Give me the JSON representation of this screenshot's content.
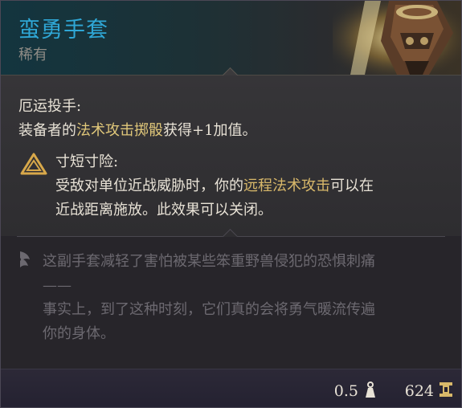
{
  "item": {
    "name": "蛮勇手套",
    "rarity": "稀有"
  },
  "passive": {
    "title": "厄运投手:",
    "desc_prefix": "装备者的",
    "desc_highlight": "法术攻击掷骰",
    "desc_suffix": "获得+1加值。"
  },
  "condition": {
    "title": "寸短寸险:",
    "line1_prefix": "受敌对单位近战威胁时，你的",
    "line1_highlight": "远程法术攻击",
    "line1_suffix": "可以在",
    "line2": "近战距离施放。此效果可以关闭。"
  },
  "flavor": {
    "line1": "这副手套减轻了害怕被某些笨重野兽侵犯的恐惧刺痛",
    "line2": "——",
    "line3": "事实上，到了这种时刻，它们真的会将勇气暖流传遍",
    "line4": "你的身体。"
  },
  "footer": {
    "weight": "0.5",
    "value": "624"
  },
  "icons": {
    "condition": "warning-triangle-icon",
    "flavor": "quill-icon",
    "weight": "weight-icon",
    "value": "gold-coin-icon"
  },
  "colors": {
    "name": "#2fa7d6",
    "highlight": "#e0c77a",
    "text": "#e8e2d6",
    "flavor": "#6c6970"
  }
}
